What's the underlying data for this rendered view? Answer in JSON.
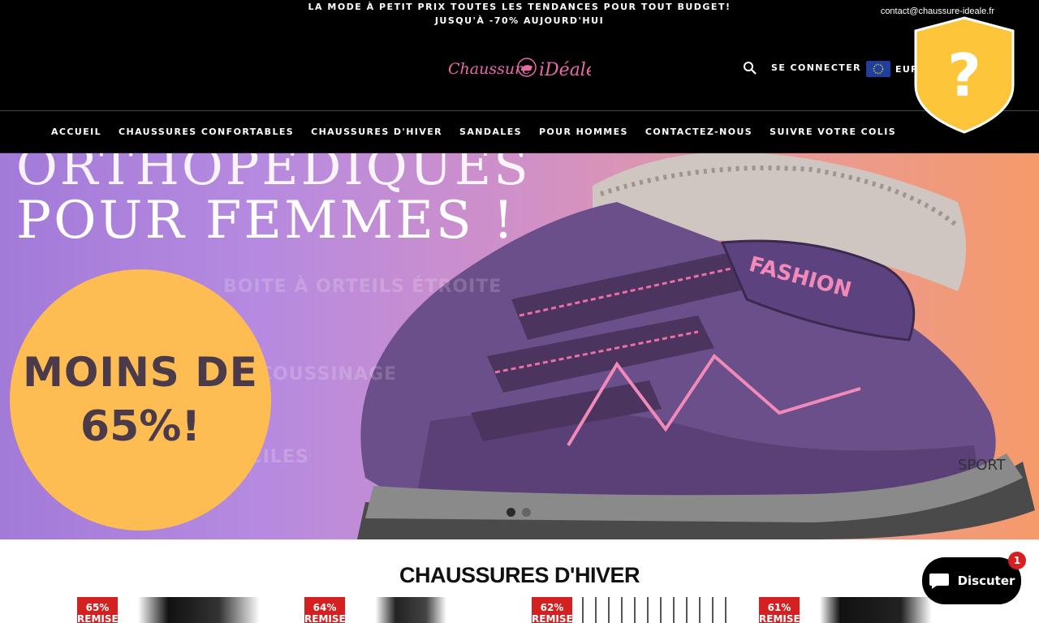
{
  "announcement": {
    "line1": "LA MODE À PETIT PRIX TOUTES LES TENDANCES POUR TOUT BUDGET!",
    "line2": "JUSQU'À -70% AUJOURD'HUI",
    "email": "contact@chaussure-ideale.fr"
  },
  "header": {
    "logo_text": "Chaussure iDéale",
    "login_label": "SE CONNECTER",
    "currency_label": "EUR",
    "search_icon": "search-icon"
  },
  "nav": {
    "items": [
      {
        "label": "ACCUEIL"
      },
      {
        "label": "CHAUSSURES CONFORTABLES"
      },
      {
        "label": "CHAUSSURES D'HIVER"
      },
      {
        "label": "SANDALES"
      },
      {
        "label": "POUR HOMMES"
      },
      {
        "label": "CONTACTEZ-NOUS"
      },
      {
        "label": "SUIVRE VOTRE COLIS"
      }
    ]
  },
  "hero": {
    "headline_top": "ORTHOPÉDIQUES",
    "headline": "POUR FEMMES !",
    "ghost_lines": [
      "BOITE À ORTEILS ÉTROITE",
      "DE COUSSINAGE",
      "FACILES"
    ],
    "badge_line1": "MOINS DE",
    "badge_line2": "65%!",
    "shoe_text": "FASHION",
    "shoe_brand": "SPORT",
    "slides": 2,
    "active_slide": 1
  },
  "section": {
    "title": "CHAUSSURES D'HIVER"
  },
  "products": [
    {
      "discount": "65%",
      "label": "REMISE"
    },
    {
      "discount": "64%",
      "label": "REMISE"
    },
    {
      "discount": "62%",
      "label": "REMISE"
    },
    {
      "discount": "61%",
      "label": "REMISE"
    }
  ],
  "help_widget": {
    "symbol": "?"
  },
  "chat": {
    "label": "Discuter",
    "badge_count": "1"
  },
  "colors": {
    "accent": "#fdbd52",
    "discount": "#d42020",
    "shield": "#fcc53a"
  }
}
